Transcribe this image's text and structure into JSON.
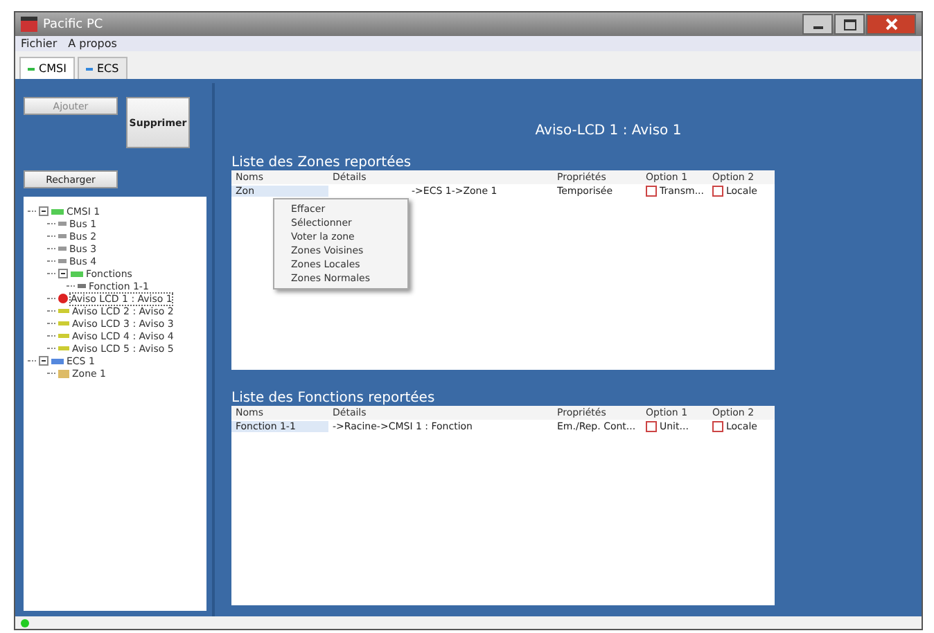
{
  "window": {
    "title": "Pacific PC"
  },
  "menu": [
    "Fichier",
    "A propos"
  ],
  "tabs": [
    {
      "label": "CMSI",
      "selected": true,
      "color": "#33bb44"
    },
    {
      "label": "ECS",
      "selected": false,
      "color": "#3388dd"
    }
  ],
  "sidebar": {
    "add_button": "Ajouter",
    "delete_button": "Supprimer",
    "reload_button": "Recharger",
    "tree": [
      {
        "label": "CMSI 1",
        "kind": "root",
        "selected": false,
        "expanded": true,
        "children": [
          {
            "label": "Bus 1",
            "kind": "bus",
            "selected": false
          },
          {
            "label": "Bus 2",
            "kind": "bus",
            "selected": false
          },
          {
            "label": "Bus 3",
            "kind": "bus",
            "selected": false
          },
          {
            "label": "Bus 4",
            "kind": "bus",
            "selected": false
          },
          {
            "label": "Fonctions",
            "kind": "root",
            "selected": false,
            "expanded": true,
            "children": [
              {
                "label": "Fonction 1-1",
                "kind": "function",
                "selected": false
              }
            ]
          },
          {
            "label": "Aviso LCD 1 : Aviso 1",
            "kind": "aviso",
            "selected": true
          },
          {
            "label": "Aviso LCD 2 : Aviso 2",
            "kind": "aviso",
            "selected": false
          },
          {
            "label": "Aviso LCD 3 : Aviso 3",
            "kind": "aviso",
            "selected": false
          },
          {
            "label": "Aviso LCD 4 : Aviso 4",
            "kind": "aviso",
            "selected": false
          },
          {
            "label": "Aviso LCD 5 : Aviso 5",
            "kind": "aviso",
            "selected": false
          }
        ]
      },
      {
        "label": "ECS 1",
        "kind": "root2",
        "selected": false,
        "expanded": true,
        "children": [
          {
            "label": "Zone 1",
            "kind": "zone",
            "selected": false
          }
        ]
      }
    ]
  },
  "main": {
    "title": "Aviso-LCD 1 : Aviso 1",
    "zones": {
      "title": "Liste des  Zones reportées",
      "columns": [
        "Noms",
        "Détails",
        "Propriétés",
        "Option 1",
        "Option 2"
      ],
      "rows": [
        {
          "name": "Zon",
          "details": "->ECS 1->Zone 1",
          "properties": "Temporisée",
          "option_1": {
            "label": "Transm...",
            "checked": false
          },
          "option_2": {
            "label": "Locale",
            "checked": false
          },
          "selected": true
        }
      ],
      "context_menu": [
        "Effacer",
        "Sélectionner",
        "Voter la zone",
        "Zones Voisines",
        "Zones Locales",
        "Zones Normales"
      ]
    },
    "functions": {
      "title": "Liste des Fonctions reportées",
      "columns": [
        "Noms",
        "Détails",
        "Propriétés",
        "Option 1",
        "Option 2"
      ],
      "rows": [
        {
          "name": "Fonction 1-1",
          "details": "->Racine->CMSI 1 : Fonction",
          "properties": "Em./Rep. Cont...",
          "option_1": {
            "label": "Unit...",
            "checked": false
          },
          "option_2": {
            "label": "Locale",
            "checked": false
          },
          "selected": true
        }
      ]
    }
  }
}
